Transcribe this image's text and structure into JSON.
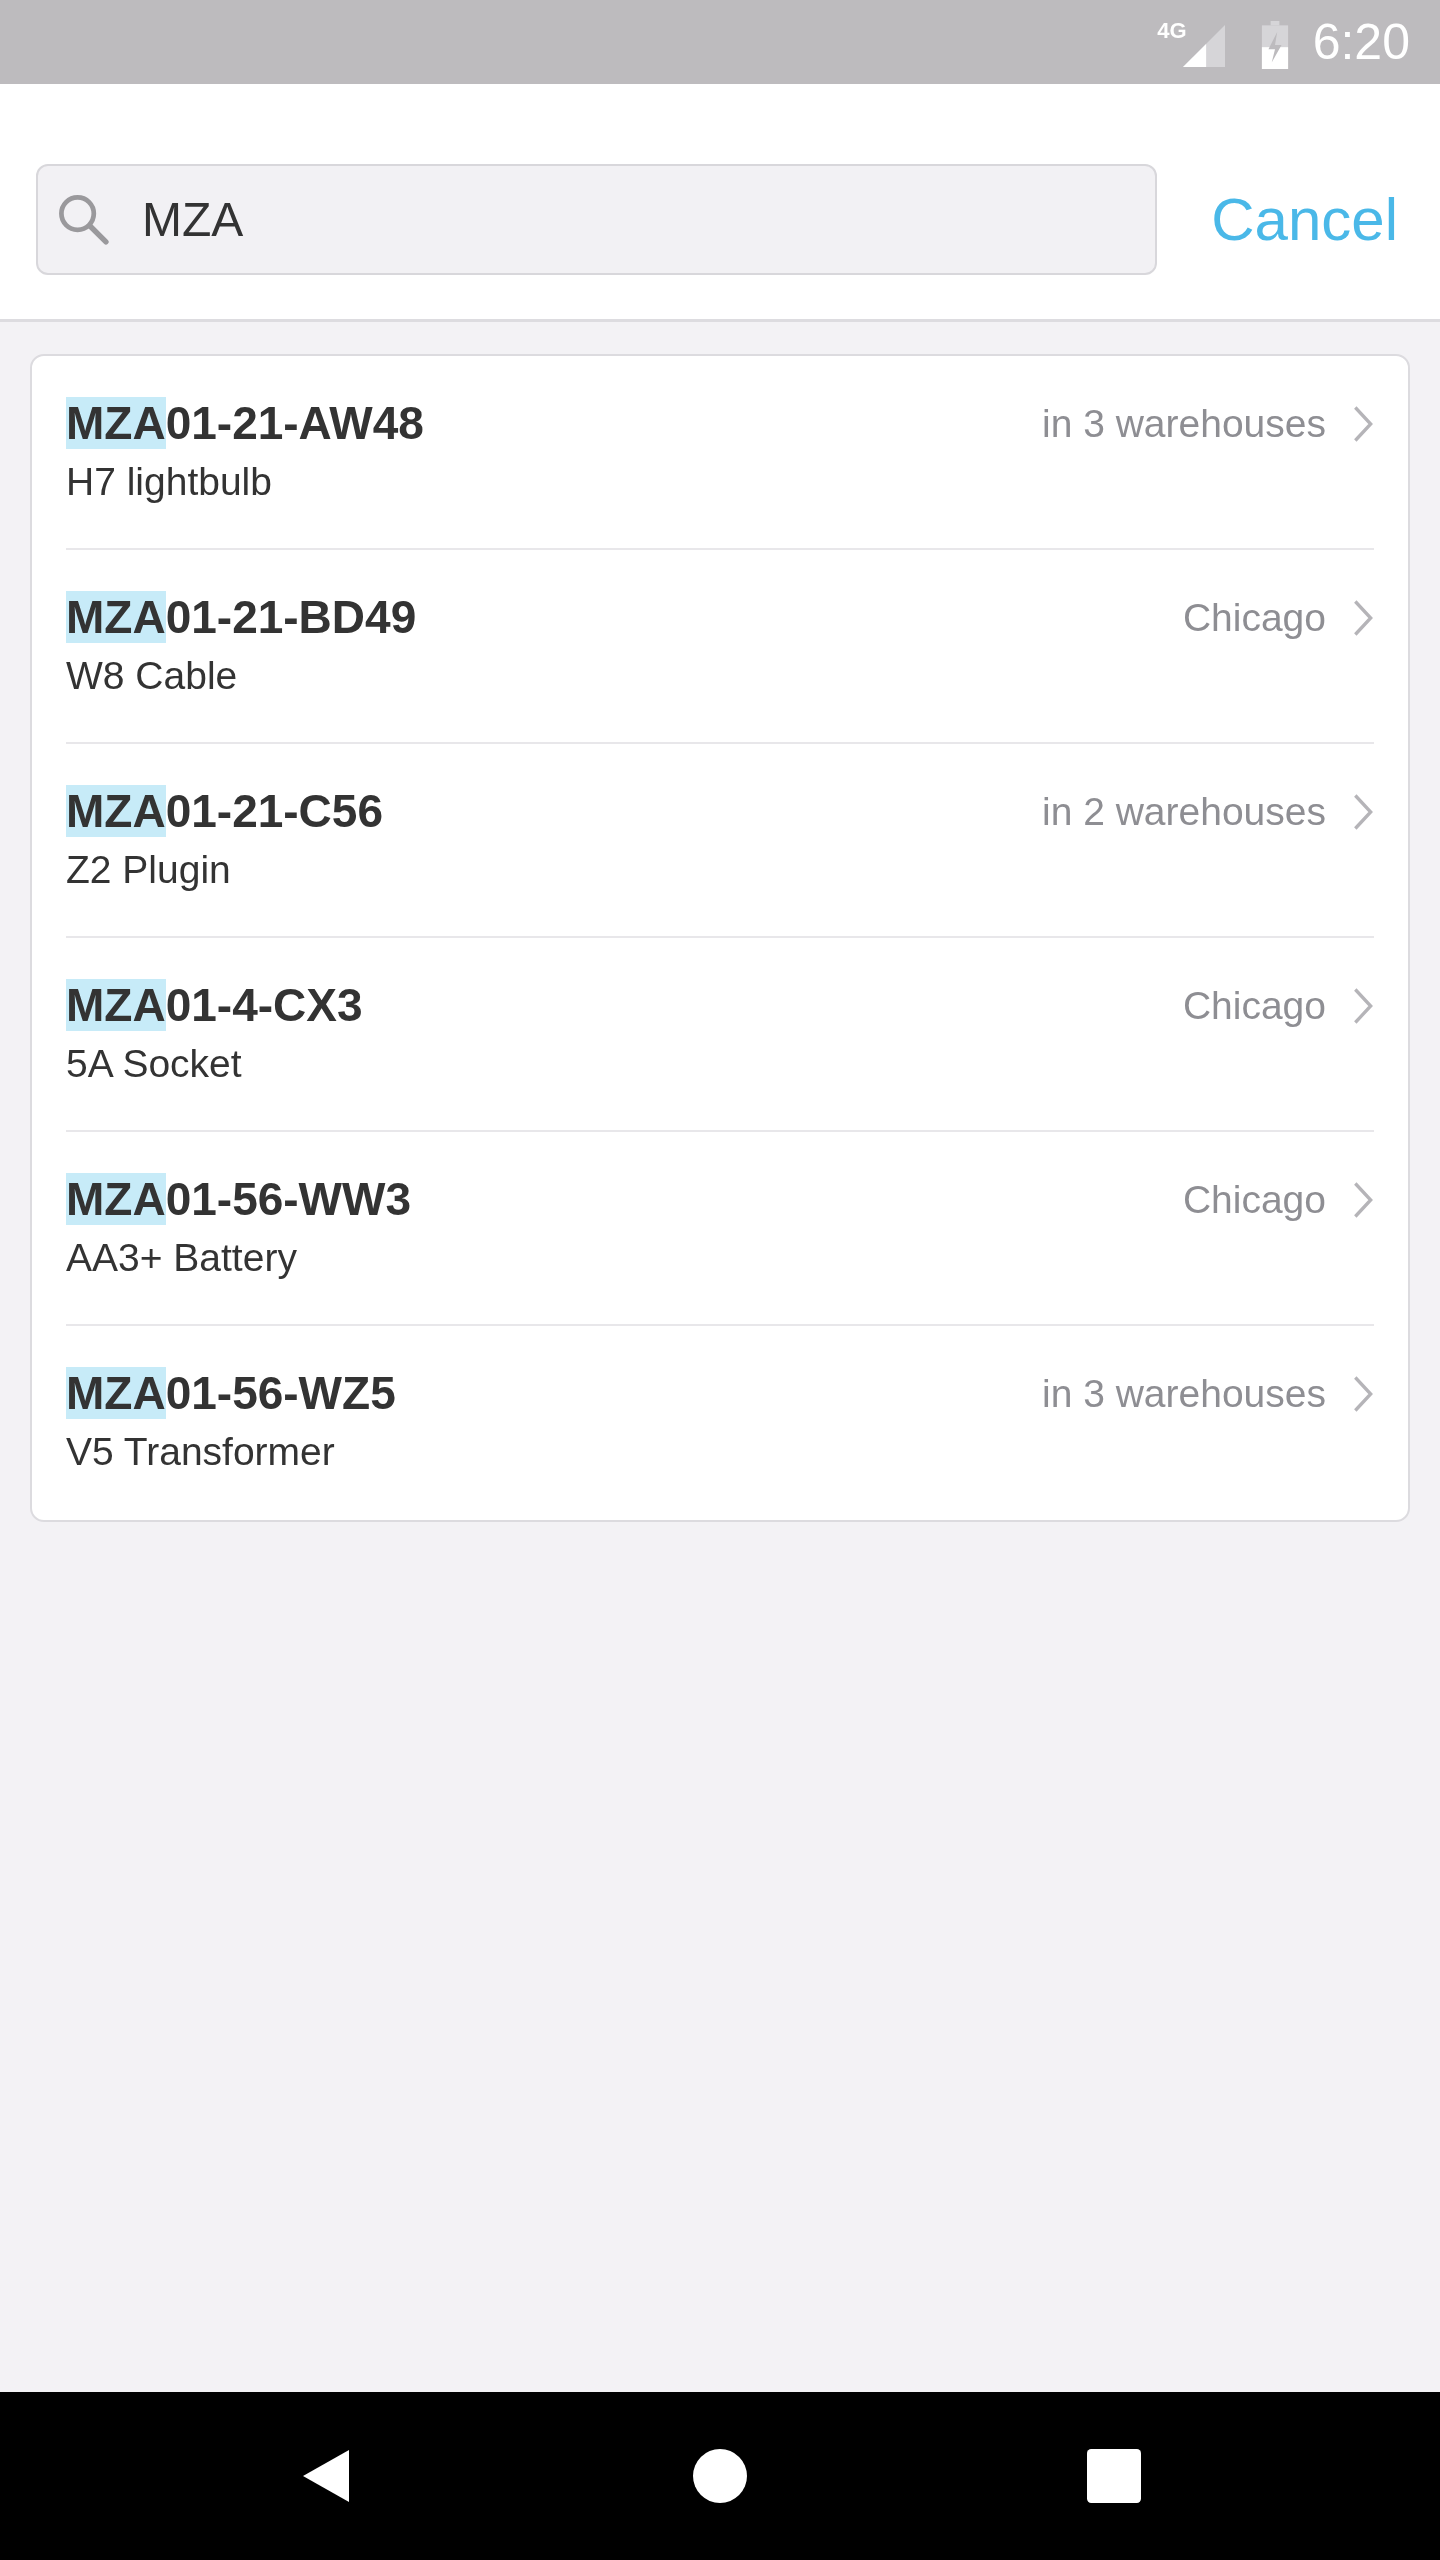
{
  "status_bar": {
    "network": "4G",
    "time": "6:20"
  },
  "search": {
    "value": "MZA",
    "cancel": "Cancel"
  },
  "results": [
    {
      "code": "MZA01-21-AW48",
      "name": "H7 lightbulb",
      "location": "in 3 warehouses"
    },
    {
      "code": "MZA01-21-BD49",
      "name": "W8 Cable",
      "location": "Chicago"
    },
    {
      "code": "MZA01-21-C56",
      "name": "Z2 Plugin",
      "location": "in 2 warehouses"
    },
    {
      "code": "MZA01-4-CX3",
      "name": "5A Socket",
      "location": "Chicago"
    },
    {
      "code": "MZA01-56-WW3",
      "name": "AA3+ Battery",
      "location": "Chicago"
    },
    {
      "code": "MZA01-56-WZ5",
      "name": "V5 Transformer",
      "location": "in 3 warehouses"
    }
  ]
}
